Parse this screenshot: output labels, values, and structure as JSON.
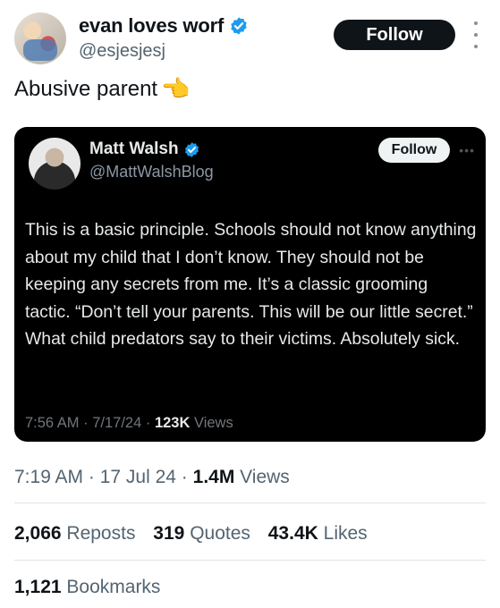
{
  "post": {
    "author": {
      "display_name": "evan loves worf",
      "handle": "@esjesjesj",
      "verified": true
    },
    "follow_label": "Follow",
    "text": "Abusive parent",
    "emoji": "👈",
    "timestamp_time": "7:19 AM",
    "timestamp_date": "17 Jul 24",
    "views_value": "1.4M",
    "views_label": "Views",
    "stats": {
      "reposts_value": "2,066",
      "reposts_label": "Reposts",
      "quotes_value": "319",
      "quotes_label": "Quotes",
      "likes_value": "43.4K",
      "likes_label": "Likes",
      "bookmarks_value": "1,121",
      "bookmarks_label": "Bookmarks"
    }
  },
  "quoted": {
    "author": {
      "display_name": "Matt Walsh",
      "handle": "@MattWalshBlog",
      "verified": true
    },
    "follow_label": "Follow",
    "text": "This is a basic principle. Schools should not know anything about my child that I don’t know. They should not be keeping any secrets from me. It’s a classic grooming tactic. “Don’t tell your parents. This will be our little secret.” What child predators say to their victims. Absolutely sick.",
    "time": "7:56 AM",
    "date": "7/17/24",
    "views_value": "123K",
    "views_label": "Views"
  },
  "colors": {
    "verified_blue": "#1d9bf0",
    "text_primary": "#0f1419",
    "text_secondary": "#536471",
    "quote_bg": "#000000"
  },
  "icons": [
    "verified-badge-icon",
    "more-options-icon",
    "pointing-hand-emoji"
  ]
}
